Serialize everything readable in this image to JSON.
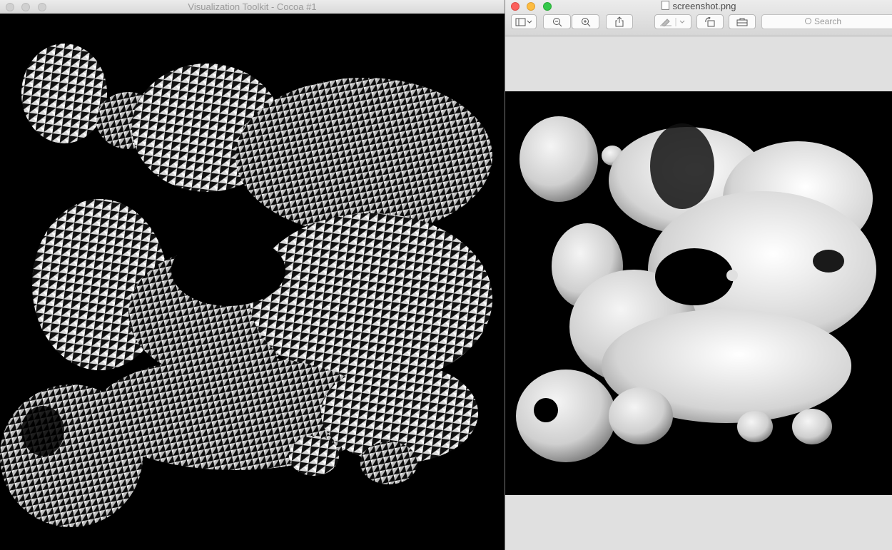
{
  "vtk_window": {
    "title": "Visualization Toolkit - Cocoa #1",
    "viewport_description_icon": "vtk-render-view"
  },
  "preview_window": {
    "title": "screenshot.png",
    "toolbar": {
      "sidebar_icon": "sidebar-toggle-icon",
      "zoom_out_icon": "zoom-out-icon",
      "zoom_in_icon": "zoom-in-icon",
      "share_icon": "share-icon",
      "markup_icon": "markup-pen-icon",
      "rotate_icon": "rotate-left-icon",
      "toolbox_icon": "toolbox-icon",
      "search_placeholder": "Search"
    }
  },
  "colors": {
    "close": "#fc605c",
    "minimize": "#fdbc40",
    "zoom": "#34c84a",
    "render_background": "#000000"
  }
}
